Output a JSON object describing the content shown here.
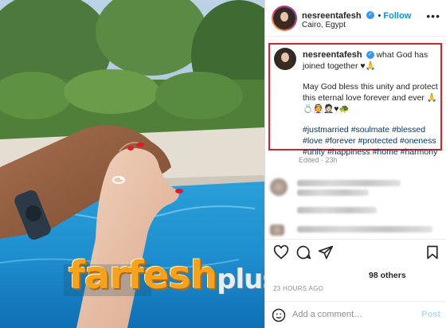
{
  "post": {
    "username": "nesreentafesh",
    "follow_label": "Follow",
    "location": "Cairo, Egypt",
    "more_label": "•••",
    "caption_line1": "what God has joined together ♥🙏",
    "caption_line2": "May God bless this unity and protect this eternal love forever and ever 🙏 💍👰🤵🏻♥🐢",
    "hashtags": [
      "#justmarried",
      "#soulmate",
      "#blessed",
      "#love",
      "#forever",
      "#protected",
      "#oneness",
      "#unity",
      "#happiness",
      "#home",
      "#harmony"
    ],
    "edited": "Edited · 23h",
    "likes_suffix": "98 others",
    "timestamp": "23 HOURS AGO",
    "comment_placeholder": "Add a comment…",
    "post_label": "Post"
  },
  "watermark": {
    "main": "farfesh",
    "sub": "plus.com"
  },
  "icons": {
    "heart": "heart-icon",
    "comment": "comment-icon",
    "share": "share-icon",
    "save": "bookmark-icon",
    "emoji": "emoji-icon",
    "verified": "verified-badge-icon"
  },
  "colors": {
    "follow": "#0095f6",
    "hashtag": "#00376b",
    "highlight": "#d0262a",
    "watermark_orange": "#f6a21d"
  }
}
